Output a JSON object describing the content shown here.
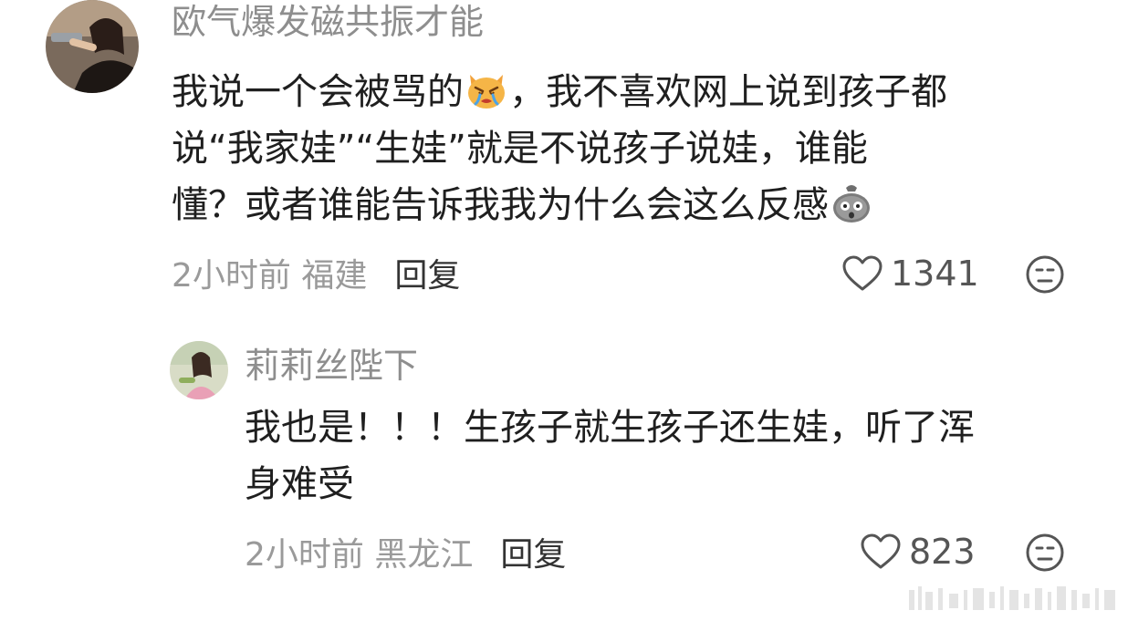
{
  "comments": [
    {
      "username": "欧气爆发磁共振才能",
      "body": {
        "line1_before_emoji": "我说一个会被骂的",
        "line1_emoji": "crying-cat-emoji",
        "line1_after_emoji": "，我不喜欢网上说到孩子都",
        "line2": "说“我家娃”“生娃”就是不说孩子说娃，谁能",
        "line3_text": "懂？或者谁能告诉我我为什么会这么反感",
        "line3_emoji": "shocked-bag-emoji"
      },
      "meta": {
        "time_location": "2小时前 福建",
        "reply_label": "回复"
      },
      "likes": "1341",
      "reaction_icon": "neutral-face-icon"
    },
    {
      "username": "莉莉丝陛下",
      "body": {
        "line1": "我也是！！！生孩子就生孩子还生娃，听了浑",
        "line2": "身难受"
      },
      "meta": {
        "time_location": "2小时前 黑龙江",
        "reply_label": "回复"
      },
      "likes": "823",
      "reaction_icon": "neutral-face-icon"
    }
  ],
  "colors": {
    "username": "#8e8e8e",
    "body_text": "#1f1f1f",
    "meta": "#9a9a9a",
    "reply": "#333333",
    "icon_stroke": "#555555"
  }
}
